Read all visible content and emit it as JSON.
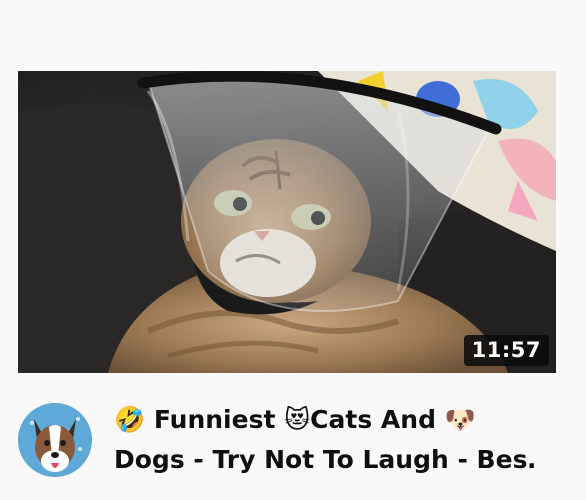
{
  "video": {
    "duration": "11:57",
    "title_line_1": "🤣 Funniest 😻Cats And 🐶",
    "title_line_2": "Dogs - Try Not To Laugh - Bes…"
  },
  "colors": {
    "page_background": "#f9f9f9",
    "duration_badge": "#0a0a0a",
    "title_text": "#0f0f0f",
    "avatar_background": "#5fa9d9"
  },
  "icons": {
    "avatar": "cartoon-dog-avatar-icon"
  }
}
